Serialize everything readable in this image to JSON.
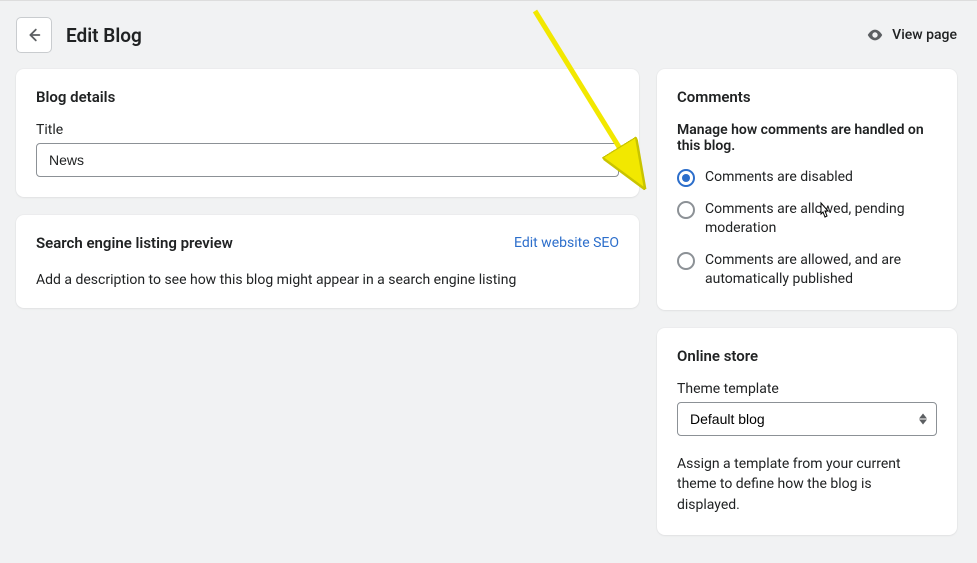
{
  "header": {
    "page_title": "Edit Blog",
    "view_page": "View page"
  },
  "blog_details": {
    "title": "Blog details",
    "title_label": "Title",
    "title_value": "News"
  },
  "seo": {
    "title": "Search engine listing preview",
    "edit_link": "Edit website SEO",
    "description": "Add a description to see how this blog might appear in a search engine listing"
  },
  "comments": {
    "title": "Comments",
    "subheading": "Manage how comments are handled on this blog.",
    "options": [
      "Comments are disabled",
      "Comments are allowed, pending moderation",
      "Comments are allowed, and are automatically published"
    ],
    "selected_index": 0
  },
  "online_store": {
    "title": "Online store",
    "theme_label": "Theme template",
    "theme_value": "Default blog",
    "hint": "Assign a template from your current theme to define how the blog is displayed."
  }
}
